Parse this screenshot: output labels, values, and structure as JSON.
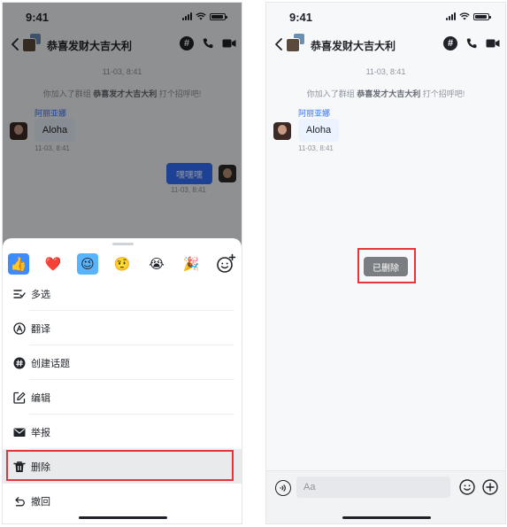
{
  "left_screen": {
    "status": {
      "time": "9:41"
    },
    "nav": {
      "title": "恭喜发财大吉大利",
      "hash_symbol": "#"
    },
    "chat": {
      "time_divider": "11-03, 8:41",
      "system_prefix": "你加入了群组",
      "system_group": "恭喜发才大吉大利",
      "system_suffix": "打个招呼吧!",
      "sender_name": "阿丽亚娜",
      "incoming_text": "Aloha",
      "incoming_time": "11-03, 8:41",
      "outgoing_text": "嘿嘿嘿",
      "outgoing_time": "11-03, 8:41"
    },
    "reactions": [
      {
        "emoji": "👍",
        "icon": "thumbs-up-icon"
      },
      {
        "emoji": "❤️",
        "icon": "heart-icon"
      },
      {
        "emoji": "😉",
        "icon": "wink-icon"
      },
      {
        "emoji": "🤨",
        "icon": "raised-eyebrow-icon"
      },
      {
        "emoji": "😭",
        "icon": "crying-icon"
      },
      {
        "emoji": "🎉",
        "icon": "party-popper-icon"
      }
    ],
    "menu": [
      {
        "label": "多选",
        "icon": "multi-select-icon"
      },
      {
        "label": "翻译",
        "icon": "translate-icon"
      },
      {
        "label": "创建话题",
        "icon": "topic-icon"
      },
      {
        "label": "编辑",
        "icon": "edit-icon"
      },
      {
        "label": "举报",
        "icon": "report-icon"
      },
      {
        "label": "删除",
        "icon": "delete-icon"
      },
      {
        "label": "撤回",
        "icon": "recall-icon"
      }
    ]
  },
  "right_screen": {
    "status": {
      "time": "9:41"
    },
    "nav": {
      "title": "恭喜发财大吉大利",
      "hash_symbol": "#"
    },
    "chat": {
      "time_divider": "11-03, 8:41",
      "system_prefix": "你加入了群组",
      "system_group": "恭喜发才大吉大利",
      "system_suffix": "打个招呼吧!",
      "sender_name": "阿丽亚娜",
      "incoming_text": "Aloha",
      "incoming_time": "11-03, 8:41"
    },
    "toast": "已删除",
    "input": {
      "placeholder": "Aa"
    }
  },
  "colors": {
    "accent": "#3370ff",
    "highlight_border": "#e3353a",
    "toast_bg": "#7a7d81"
  }
}
